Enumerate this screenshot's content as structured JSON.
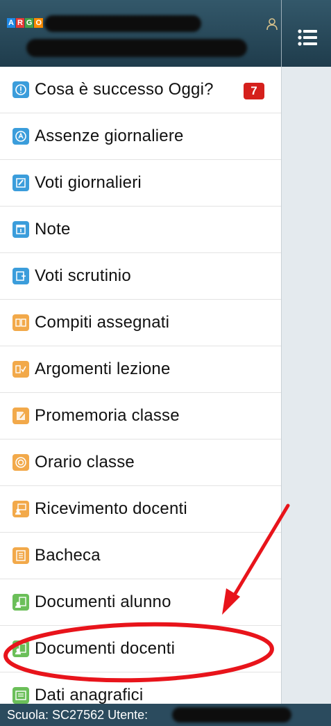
{
  "header": {
    "logo_letters": [
      "A",
      "R",
      "G",
      "O"
    ],
    "logo_colors": [
      "#1e88e5",
      "#e53935",
      "#43a047",
      "#fb8c00"
    ],
    "user_icon": "user-icon",
    "menu_icon": "list-menu-icon"
  },
  "menu": {
    "items": [
      {
        "label": "Cosa è successo Oggi?",
        "icon": "info-icon",
        "color": "#3b9ddb",
        "badge": "7"
      },
      {
        "label": "Assenze giornaliere",
        "icon": "absence-icon",
        "color": "#3b9ddb"
      },
      {
        "label": "Voti giornalieri",
        "icon": "daily-grades-icon",
        "color": "#3b9ddb"
      },
      {
        "label": "Note",
        "icon": "note-icon",
        "color": "#3b9ddb"
      },
      {
        "label": "Voti scrutinio",
        "icon": "final-grades-icon",
        "color": "#3b9ddb"
      },
      {
        "label": "Compiti assegnati",
        "icon": "homework-icon",
        "color": "#f2a94a"
      },
      {
        "label": "Argomenti lezione",
        "icon": "lesson-topics-icon",
        "color": "#f2a94a"
      },
      {
        "label": "Promemoria classe",
        "icon": "reminder-icon",
        "color": "#f2a94a"
      },
      {
        "label": "Orario classe",
        "icon": "timetable-icon",
        "color": "#f2a94a"
      },
      {
        "label": "Ricevimento docenti",
        "icon": "teacher-meeting-icon",
        "color": "#f2a94a"
      },
      {
        "label": "Bacheca",
        "icon": "noticeboard-icon",
        "color": "#f2a94a"
      },
      {
        "label": "Documenti alunno",
        "icon": "student-documents-icon",
        "color": "#6bbf59"
      },
      {
        "label": "Documenti docenti",
        "icon": "teacher-documents-icon",
        "color": "#6bbf59"
      },
      {
        "label": "Dati anagrafici",
        "icon": "personal-data-icon",
        "color": "#6bbf59"
      }
    ]
  },
  "footer": {
    "text": "Scuola: SC27562 Utente:"
  },
  "annotation": {
    "color": "#e8141b"
  }
}
